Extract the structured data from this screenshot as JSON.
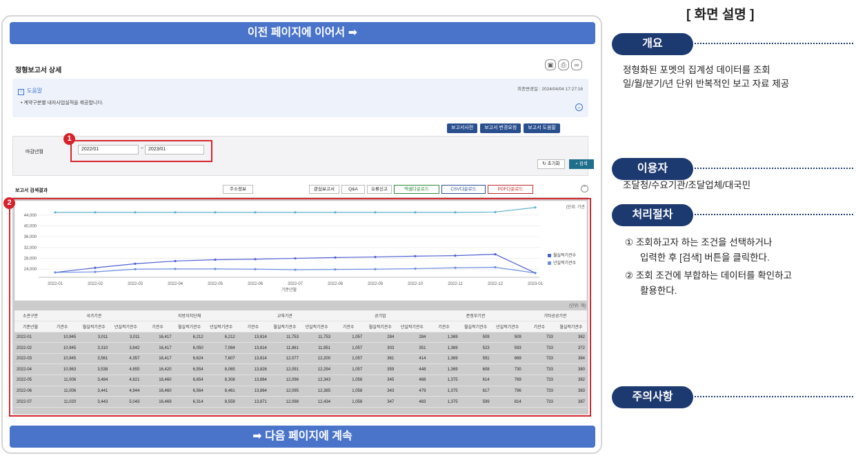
{
  "banner_top": "이전 페이지에 이어서 ➡",
  "banner_bottom": "➡ 다음 페이지에 계속",
  "page_title": "정형보고서 상세",
  "help": {
    "title": "도움말",
    "desc": "• 계약구분별 내자사업실적을 제공합니다.",
    "updated": "최종변경일 : 2024/04/04 17:27:16"
  },
  "buttons": {
    "dict": "보고서사전",
    "change": "보고서 변경요청",
    "help": "보고서 도움말",
    "reset": "초기화",
    "search": "검색"
  },
  "filter": {
    "label": "마감년월",
    "from": "2022/01",
    "to": "2023/01",
    "sep": "~"
  },
  "results": {
    "label": "보고서 검색결과",
    "summary": "주소정보",
    "fav": "관심보고서",
    "qa": "Q&A",
    "err": "오류신고",
    "excel": "엑셀다운로드",
    "csv": "CSV다운로드",
    "pdf": "PDF다운로드"
  },
  "markers": {
    "one": "1",
    "two": "2"
  },
  "chart_data": {
    "type": "line",
    "x": [
      "2022-01",
      "2022-02",
      "2022-03",
      "2022-04",
      "2022-05",
      "2022-06",
      "2022-07",
      "2022-08",
      "2022-09",
      "2022-10",
      "2022-11",
      "2022-12",
      "2023-01"
    ],
    "xlabel": "기준년월",
    "ylim": [
      21000,
      47000
    ],
    "yticks": [
      24000,
      28000,
      32000,
      36000,
      40000,
      44000
    ],
    "unit": "(단위: 기관",
    "legend_position": "right",
    "series": [
      {
        "name": "",
        "color": "#5bb2c9",
        "values": [
          45000,
          45000,
          45000,
          45000,
          45000,
          45000,
          45000,
          45000,
          45000,
          45000,
          45000,
          45100,
          46800
        ]
      },
      {
        "name": "월실적기관수",
        "color": "#4f5fd1",
        "values": [
          22800,
          24500,
          26000,
          27000,
          27500,
          27700,
          28000,
          28300,
          28500,
          28800,
          29000,
          29500,
          22600
        ]
      },
      {
        "name": "년실적기관수",
        "color": "#6c8ce0",
        "values": [
          22800,
          23000,
          24000,
          24100,
          24100,
          24000,
          23800,
          23900,
          24000,
          24200,
          24500,
          24700,
          22600
        ]
      }
    ]
  },
  "table": {
    "unit": "(단위: 개)",
    "groups": [
      "소관구분",
      "국가기관",
      "지방자치단체",
      "교육기관",
      "공기업",
      "준정부기관",
      "기타공공기관"
    ],
    "subheads": [
      "기준년월",
      "기관수",
      "월실적기관수",
      "년실적기관수",
      "기관수",
      "월실적기관수",
      "년실적기관수",
      "기관수",
      "월실적기관수",
      "년실적기관수",
      "기관수",
      "월실적기관수",
      "년실적기관수",
      "기관수",
      "월실적기관수",
      "년실적기관수",
      "기관수",
      "월실적기관수"
    ],
    "rows": [
      [
        "2022-01",
        "10,945",
        "3,011",
        "3,011",
        "16,417",
        "6,212",
        "6,212",
        "13,814",
        "11,753",
        "11,753",
        "1,057",
        "284",
        "284",
        "1,369",
        "509",
        "509",
        "733",
        "362"
      ],
      [
        "2022-02",
        "10,945",
        "3,310",
        "3,842",
        "16,417",
        "6,050",
        "7,084",
        "13,814",
        "11,861",
        "11,951",
        "1,057",
        "303",
        "351",
        "1,369",
        "523",
        "593",
        "733",
        "372"
      ],
      [
        "2022-03",
        "10,945",
        "3,561",
        "4,357",
        "16,417",
        "6,624",
        "7,607",
        "13,814",
        "12,077",
        "12,200",
        "1,057",
        "361",
        "414",
        "1,369",
        "591",
        "669",
        "733",
        "384"
      ],
      [
        "2022-04",
        "10,963",
        "3,538",
        "4,655",
        "16,420",
        "6,554",
        "8,065",
        "13,826",
        "12,091",
        "12,294",
        "1,057",
        "359",
        "448",
        "1,369",
        "608",
        "730",
        "733",
        "380"
      ],
      [
        "2022-05",
        "11,006",
        "3,484",
        "4,821",
        "16,460",
        "6,654",
        "8,308",
        "13,864",
        "12,096",
        "12,343",
        "1,058",
        "345",
        "468",
        "1,375",
        "614",
        "769",
        "733",
        "382"
      ],
      [
        "2022-06",
        "11,006",
        "3,441",
        "4,944",
        "16,460",
        "6,564",
        "8,461",
        "13,864",
        "12,095",
        "12,385",
        "1,058",
        "343",
        "479",
        "1,375",
        "617",
        "796",
        "733",
        "383"
      ],
      [
        "2022-07",
        "11,020",
        "3,443",
        "5,043",
        "16,469",
        "6,314",
        "8,559",
        "13,871",
        "12,098",
        "12,434",
        "1,058",
        "347",
        "483",
        "1,375",
        "599",
        "814",
        "733",
        "387"
      ]
    ]
  },
  "right": {
    "title": "[ 화면 설명 ]",
    "overview": "개요",
    "overview_l1": "정형화된 포멧의 집계성 데이터를 조회",
    "overview_l2": "일/월/분기/년 단위 반복적인 보고 자료 제공",
    "users": "이용자",
    "users_text": "조달청/수요기관/조달업체/대국민",
    "process": "처리절차",
    "step1a": "① 조회하고자 하는 조건을 선택하거나",
    "step1b": "입력한 후 [검색] 버튼을 클릭한다.",
    "step2a": "② 조회 조건에 부합하는 데이터를 확인하고",
    "step2b": "활용한다.",
    "caution": "주의사항"
  }
}
